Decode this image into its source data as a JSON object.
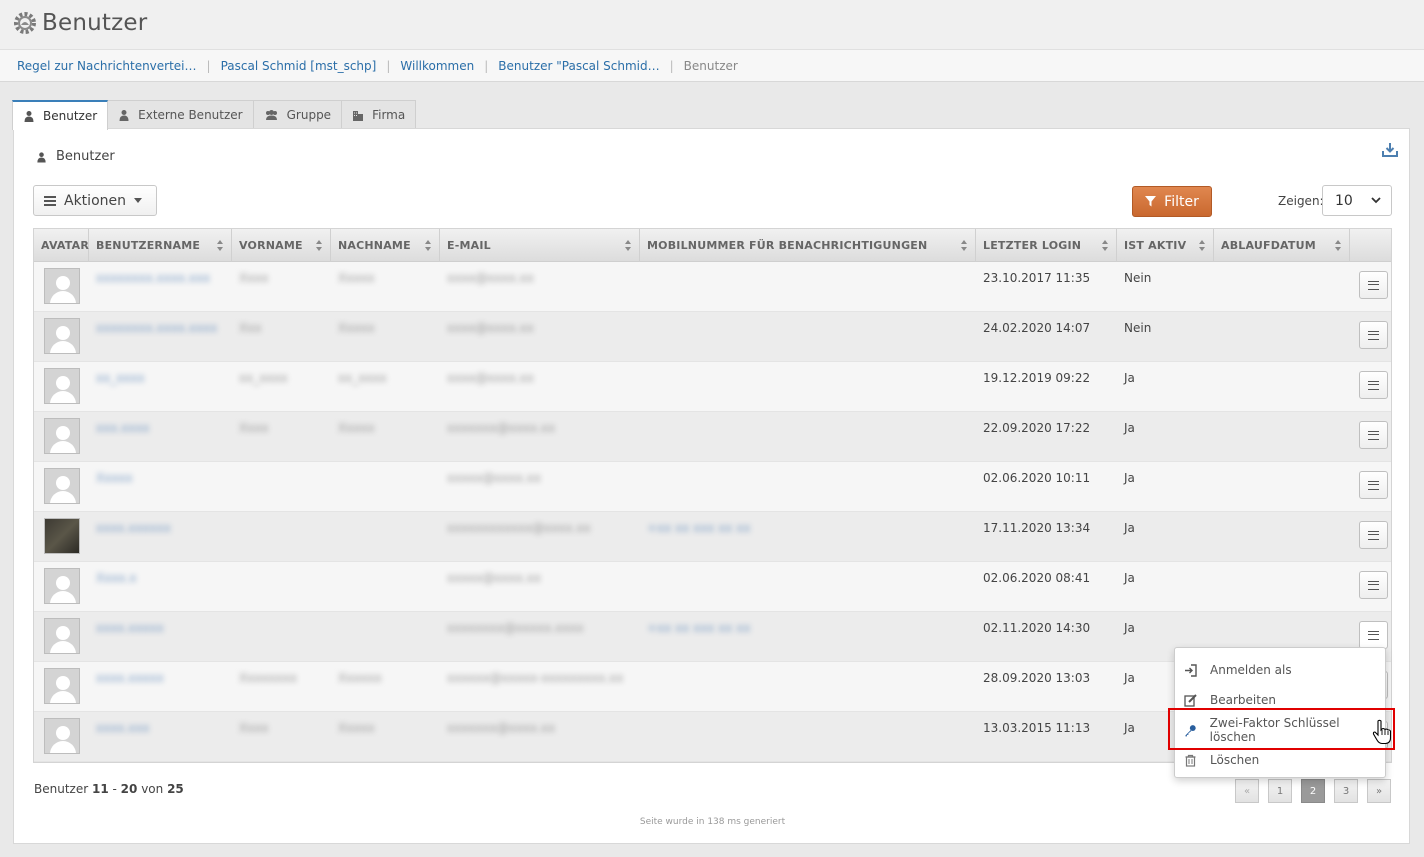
{
  "app": {
    "title": "Benutzer"
  },
  "breadcrumb": {
    "items": [
      "Regel zur Nachrichtenvertei…",
      "Pascal Schmid [mst_schp]",
      "Willkommen",
      "Benutzer \"Pascal Schmid…"
    ],
    "current": "Benutzer"
  },
  "tabs": [
    {
      "label": "Benutzer",
      "icon": "user-icon",
      "active": true
    },
    {
      "label": "Externe Benutzer",
      "icon": "user-icon",
      "active": false
    },
    {
      "label": "Gruppe",
      "icon": "group-icon",
      "active": false
    },
    {
      "label": "Firma",
      "icon": "building-icon",
      "active": false
    }
  ],
  "panel": {
    "title": "Benutzer"
  },
  "toolbar": {
    "actions_label": "Aktionen",
    "filter_label": "Filter",
    "show_label": "Zeigen:",
    "show_value": "10"
  },
  "columns": [
    "AVATAR",
    "BENUTZERNAME",
    "VORNAME",
    "NACHNAME",
    "E-MAIL",
    "MOBILNUMMER FÜR BENACHRICHTIGUNGEN",
    "LETZTER LOGIN",
    "IST AKTIV",
    "ABLAUFDATUM"
  ],
  "rows": [
    {
      "username": "xxxxxxxx.xxxx.xxx",
      "firstname": "Xxxx",
      "lastname": "Xxxxx",
      "email": "xxxx@xxxx.xx",
      "mobile": "",
      "last_login": "23.10.2017 11:35",
      "active": "Nein",
      "avatar": "placeholder"
    },
    {
      "username": "xxxxxxxx.xxxx.xxxx",
      "firstname": "Xxx",
      "lastname": "Xxxxx",
      "email": "xxxx@xxxx.xx",
      "mobile": "",
      "last_login": "24.02.2020 14:07",
      "active": "Nein",
      "avatar": "placeholder"
    },
    {
      "username": "xx_xxxx",
      "firstname": "xx_xxxx",
      "lastname": "xx_xxxx",
      "email": "xxxx@xxxx.xx",
      "mobile": "",
      "last_login": "19.12.2019 09:22",
      "active": "Ja",
      "avatar": "placeholder"
    },
    {
      "username": "xxx.xxxx",
      "firstname": "Xxxx",
      "lastname": "Xxxxx",
      "email": "xxxxxxx@xxxx.xx",
      "mobile": "",
      "last_login": "22.09.2020 17:22",
      "active": "Ja",
      "avatar": "placeholder"
    },
    {
      "username": "Xxxxx",
      "firstname": "",
      "lastname": "",
      "email": "xxxxx@xxxx.xx",
      "mobile": "",
      "last_login": "02.06.2020 10:11",
      "active": "Ja",
      "avatar": "placeholder"
    },
    {
      "username": "xxxx.xxxxxx",
      "firstname": "",
      "lastname": "",
      "email": "xxxxxxxxxxxx@xxxx.xx",
      "mobile": "+xx xx xxx xx xx",
      "last_login": "17.11.2020 13:34",
      "active": "Ja",
      "avatar": "photo"
    },
    {
      "username": "Xxxx.x",
      "firstname": "",
      "lastname": "",
      "email": "xxxxx@xxxx.xx",
      "mobile": "",
      "last_login": "02.06.2020 08:41",
      "active": "Ja",
      "avatar": "placeholder"
    },
    {
      "username": "xxxx.xxxxx",
      "firstname": "",
      "lastname": "",
      "email": "xxxxxxxx@xxxxx.xxxx",
      "mobile": "+xx xx xxx xx xx",
      "last_login": "02.11.2020 14:30",
      "active": "Ja",
      "avatar": "placeholder"
    },
    {
      "username": "xxxx.xxxxx",
      "firstname": "Xxxxxxxx",
      "lastname": "Xxxxxx",
      "email": "xxxxxx@xxxxx-xxxxxxxxx.xx",
      "mobile": "",
      "last_login": "28.09.2020 13:03",
      "active": "Ja",
      "avatar": "placeholder"
    },
    {
      "username": "xxxx.xxx",
      "firstname": "Xxxx",
      "lastname": "Xxxxx",
      "email": "xxxxxxx@xxxx.xx",
      "mobile": "",
      "last_login": "13.03.2015 11:13",
      "active": "Ja",
      "avatar": "placeholder"
    }
  ],
  "row_menu": {
    "items": [
      {
        "label": "Anmelden als",
        "icon": "sign-in-icon"
      },
      {
        "label": "Bearbeiten",
        "icon": "edit-icon"
      },
      {
        "label": "Zwei-Faktor Schlüssel löschen",
        "icon": "key-icon",
        "highlighted": true
      },
      {
        "label": "Löschen",
        "icon": "trash-icon"
      }
    ]
  },
  "pager": {
    "label": "Benutzer",
    "from": "11",
    "to": "20",
    "of_label": "von",
    "total": "25",
    "pages": [
      "«",
      "1",
      "2",
      "3",
      "»"
    ],
    "current_page": "2"
  },
  "generated_note": "Seite wurde in 138 ms generiert",
  "colors": {
    "accent": "#3a7fb9",
    "link": "#2a6ea8",
    "filter_button": "#d2763e",
    "highlight_border": "#e00000"
  }
}
